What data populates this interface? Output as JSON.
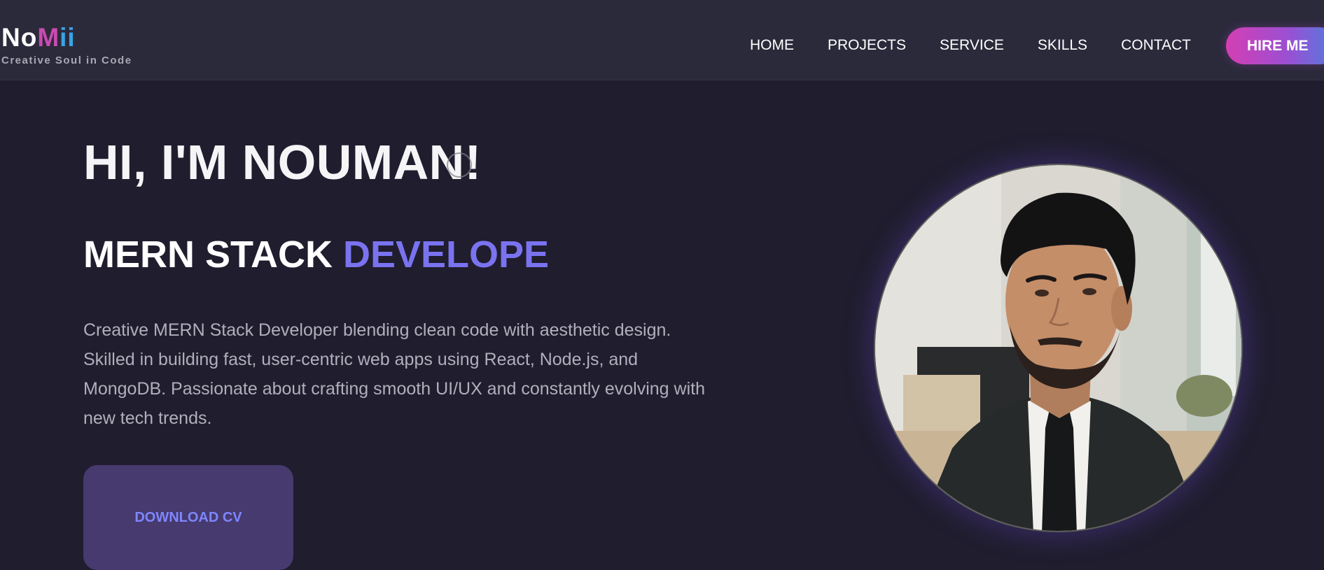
{
  "header": {
    "logo": {
      "part1": "No",
      "part2": "M",
      "part3": "ii"
    },
    "tagline": "Creative Soul in Code",
    "nav": [
      {
        "label": "HOME"
      },
      {
        "label": "PROJECTS"
      },
      {
        "label": "SERVICE"
      },
      {
        "label": "SKILLS"
      },
      {
        "label": "CONTACT"
      }
    ],
    "hire_label": "HIRE ME"
  },
  "hero": {
    "greeting": "HI, I'M NOUMAN!",
    "role_prefix": "MERN STACK ",
    "role_typed": "DEVELOPE",
    "description": "Creative MERN Stack Developer blending clean code with aesthetic design. Skilled in building fast, user-centric web apps using React, Node.js, and MongoDB. Passionate about crafting smooth UI/UX and constantly evolving with new tech trends.",
    "download_label": "DOWNLOAD CV"
  },
  "colors": {
    "background": "#201d2e",
    "navbar": "#2b2a3b",
    "accent": "#7a73f0",
    "button": "#463a6e"
  }
}
